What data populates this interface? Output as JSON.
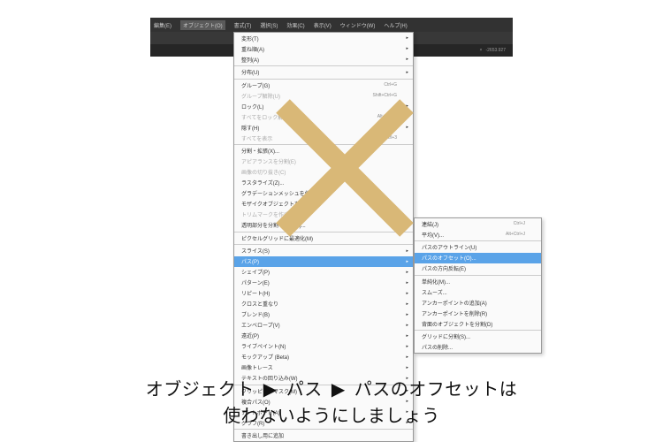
{
  "menubar": [
    "編集(E)",
    "オブジェクト(O)",
    "書式(T)",
    "選択(S)",
    "効果(C)",
    "表示(V)",
    "ウィンドウ(W)",
    "ヘルプ(H)"
  ],
  "toolbar2": [
    "×",
    "-2653.927"
  ],
  "menu": [
    {
      "t": "変形(T)",
      "sub": 1
    },
    {
      "t": "重ね順(A)",
      "sub": 1
    },
    {
      "t": "整列(A)",
      "sub": 1
    },
    {
      "t": "分布(U)",
      "sub": 1,
      "sep": 1
    },
    {
      "t": "グループ(G)",
      "sc": "Ctrl+G",
      "sep": 1
    },
    {
      "t": "グループ解除(U)",
      "sc": "Shift+Ctrl+G",
      "dis": 1
    },
    {
      "t": "ロック(L)",
      "sub": 1
    },
    {
      "t": "すべてをロック解除(K)",
      "sc": "Alt+Ctrl+2",
      "dis": 1
    },
    {
      "t": "隠す(H)",
      "sub": 1
    },
    {
      "t": "すべてを表示",
      "sc": "Alt+Ctrl+3",
      "dis": 1
    },
    {
      "t": "分割・拡張(X)...",
      "sep": 1
    },
    {
      "t": "アピアランスを分割(E)",
      "dis": 1
    },
    {
      "t": "画像の切り抜き(C)",
      "dis": 1
    },
    {
      "t": "ラスタライズ(Z)..."
    },
    {
      "t": "グラデーションメッシュを作成..."
    },
    {
      "t": "モザイクオブジェクトを作成..."
    },
    {
      "t": "トリムマークを作成(C)",
      "dis": 1
    },
    {
      "t": "透明部分を分割・統合(F)..."
    },
    {
      "t": "ピクセルグリッドに最適化(M)",
      "sep": 1
    },
    {
      "t": "スライス(S)",
      "sub": 1,
      "sep": 1
    },
    {
      "t": "パス(P)",
      "sub": 1,
      "sel": 1
    },
    {
      "t": "シェイプ(P)",
      "sub": 1
    },
    {
      "t": "パターン(E)",
      "sub": 1
    },
    {
      "t": "リピート(H)",
      "sub": 1
    },
    {
      "t": "クロスと重なり",
      "sub": 1
    },
    {
      "t": "ブレンド(B)",
      "sub": 1
    },
    {
      "t": "エンベロープ(V)",
      "sub": 1
    },
    {
      "t": "遠近(P)",
      "sub": 1
    },
    {
      "t": "ライブペイント(N)",
      "sub": 1
    },
    {
      "t": "モックアップ (Beta)",
      "sub": 1
    },
    {
      "t": "画像トレース",
      "sub": 1
    },
    {
      "t": "テキストの回り込み(W)",
      "sub": 1
    },
    {
      "t": "クリッピングマスク(M)",
      "sub": 1,
      "sep": 1
    },
    {
      "t": "複合パス(O)",
      "sub": 1
    },
    {
      "t": "アートボード(A)",
      "sub": 1
    },
    {
      "t": "グラフ(R)",
      "sub": 1
    },
    {
      "t": "書き出し用に追加",
      "sep": 1
    }
  ],
  "submenu": [
    {
      "t": "連結(J)",
      "sc": "Ctrl+J"
    },
    {
      "t": "平均(V)...",
      "sc": "Alt+Ctrl+J"
    },
    {
      "t": "パスのアウトライン(U)",
      "sep": 1
    },
    {
      "t": "パスのオフセット(O)...",
      "sel": 1
    },
    {
      "t": "パスの方向反転(E)"
    },
    {
      "t": "単純化(M)...",
      "sep": 1
    },
    {
      "t": "スムーズ..."
    },
    {
      "t": "アンカーポイントの追加(A)"
    },
    {
      "t": "アンカーポイントを削除(R)"
    },
    {
      "t": "背面のオブジェクトを分割(D)"
    },
    {
      "t": "グリッドに分割(S)...",
      "sep": 1
    },
    {
      "t": "パスの削除..."
    }
  ],
  "caption": {
    "l1a": "オブジェクト",
    "l1b": "パス",
    "l1c": "パスのオフセットは",
    "l2": "使わないようにしましょう",
    "arr": "▶"
  }
}
